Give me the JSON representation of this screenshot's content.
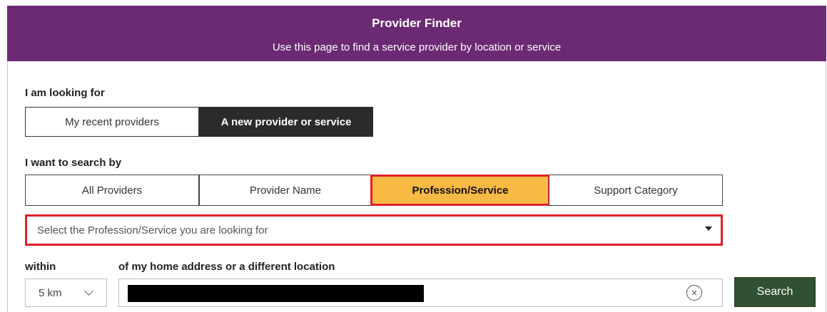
{
  "header": {
    "title": "Provider Finder",
    "subtitle": "Use this page to find a service provider by location or service"
  },
  "looking_for": {
    "label": "I am looking for",
    "options": [
      "My recent providers",
      "A new provider or service"
    ],
    "selected": "A new provider or service"
  },
  "search_by": {
    "label": "I want to search by",
    "tabs": [
      "All Providers",
      "Provider Name",
      "Profession/Service",
      "Support Category"
    ],
    "selected": "Profession/Service"
  },
  "profession_select": {
    "placeholder": "Select the Profession/Service you are looking for"
  },
  "within": {
    "label": "within",
    "value": "5 km"
  },
  "location": {
    "label": "of my home address or a different location",
    "value_redacted": true
  },
  "actions": {
    "search_label": "Search"
  },
  "colors": {
    "header_bg": "#6b2a73",
    "active_tab_bg": "#f8b945",
    "highlight_border": "#e0202a",
    "search_button_bg": "#2f5233",
    "selected_toggle_bg": "#2b2b2b"
  },
  "icons": {
    "select_caret": "caret-down-icon",
    "km_chevron": "chevron-down-icon",
    "clear": "clear-circle-icon"
  }
}
